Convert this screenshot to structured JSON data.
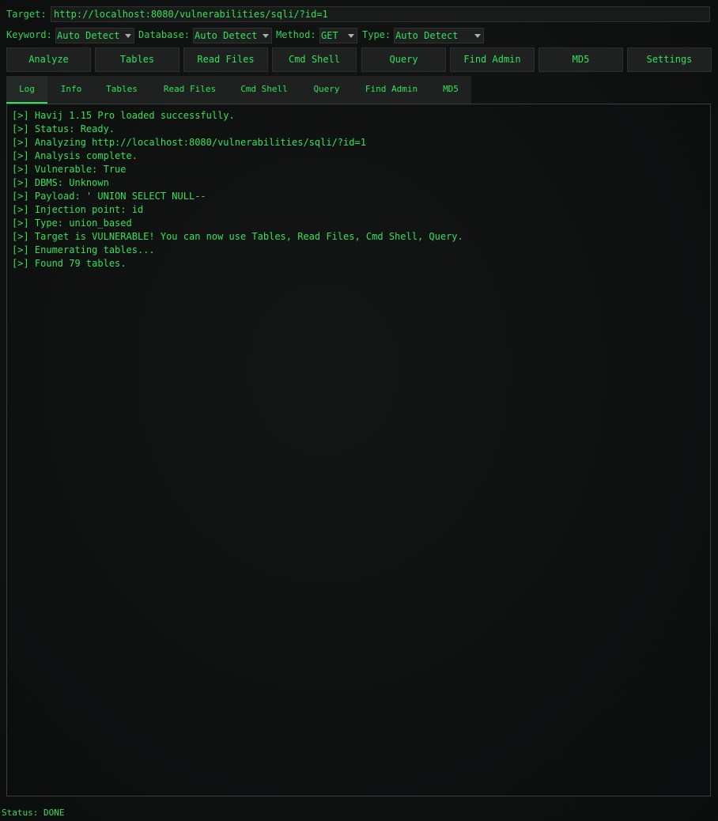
{
  "target": {
    "label": "Target:",
    "value": "http://localhost:8080/vulnerabilities/sqli/?id=1"
  },
  "options": {
    "keyword": {
      "label": "Keyword:",
      "value": "Auto Detect"
    },
    "database": {
      "label": "Database:",
      "value": "Auto Detect"
    },
    "method": {
      "label": "Method:",
      "value": "GET"
    },
    "type": {
      "label": "Type:",
      "value": "Auto Detect"
    }
  },
  "toolbar": [
    "Analyze",
    "Tables",
    "Read Files",
    "Cmd Shell",
    "Query",
    "Find Admin",
    "MD5",
    "Settings"
  ],
  "tabs": [
    "Log",
    "Info",
    "Tables",
    "Read Files",
    "Cmd Shell",
    "Query",
    "Find Admin",
    "MD5"
  ],
  "active_tab": "Log",
  "log": [
    "[>] Havij 1.15 Pro loaded successfully.",
    "[>] Status: Ready.",
    "[>] Analyzing http://localhost:8080/vulnerabilities/sqli/?id=1",
    "[>] Analysis complete.",
    "[>] Vulnerable: True",
    "[>] DBMS: Unknown",
    "[>] Payload: ' UNION SELECT NULL--",
    "[>] Injection point: id",
    "[>] Type: union_based",
    "[>] Target is VULNERABLE! You can now use Tables, Read Files, Cmd Shell, Query.",
    "[>] Enumerating tables...",
    "[>] Found 79 tables."
  ],
  "status": "Status: DONE",
  "colors": {
    "accent": "#33e05a",
    "background": "#121413"
  }
}
